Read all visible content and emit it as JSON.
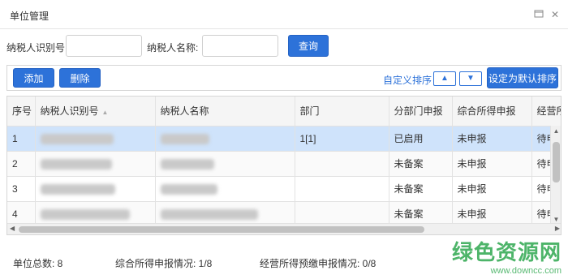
{
  "window": {
    "title": "单位管理",
    "icons": [
      "window-restore-icon",
      "close-icon"
    ]
  },
  "search": {
    "id_label": "纳税人识别号:",
    "id_value": "",
    "name_label": "纳税人名称:",
    "name_value": "",
    "query_button": "查询"
  },
  "toolbar": {
    "add_button": "添加",
    "delete_button": "删除",
    "custom_sort_link": "自定义排序",
    "up_arrow": "▲",
    "down_arrow": "▼",
    "set_default_button": "设定为默认排序"
  },
  "table": {
    "columns": [
      "序号",
      "纳税人识别号",
      "纳税人名称",
      "部门",
      "分部门申报",
      "综合所得申报",
      "经营所"
    ],
    "rows": [
      {
        "index": "1",
        "dept": "1[1]",
        "branch": "已启用",
        "comprehensive": "未申报",
        "business": "待申",
        "selected": true
      },
      {
        "index": "2",
        "dept": "",
        "branch": "未备案",
        "comprehensive": "未申报",
        "business": "待申",
        "selected": false
      },
      {
        "index": "3",
        "dept": "",
        "branch": "未备案",
        "comprehensive": "未申报",
        "business": "待申",
        "selected": false
      },
      {
        "index": "4",
        "dept": "",
        "branch": "未备案",
        "comprehensive": "未申报",
        "business": "待申",
        "selected": false
      }
    ]
  },
  "status": {
    "unit_total": "单位总数: 8",
    "comprehensive_status": "综合所得申报情况: 1/8",
    "business_status": "经营所得预缴申报情况: 0/8"
  },
  "watermark": {
    "text": "绿色资源网",
    "url": "www.downcc.com"
  },
  "colors": {
    "accent": "#2d72d9",
    "selected_row": "#cfe3fb",
    "watermark": "#2fa84f"
  }
}
